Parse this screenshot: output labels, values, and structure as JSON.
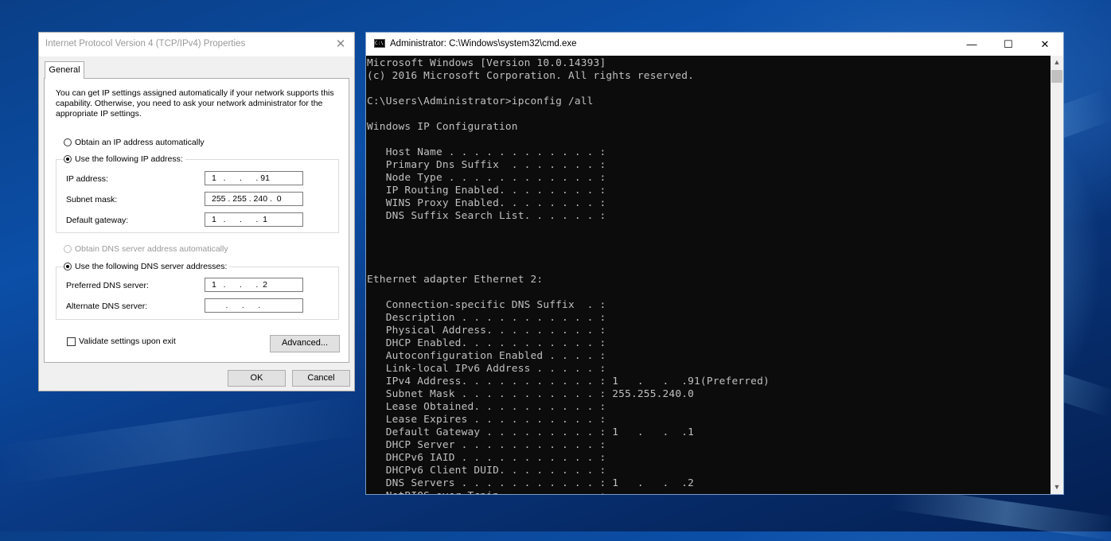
{
  "ipv4_dialog": {
    "title": "Internet Protocol Version 4 (TCP/IPv4) Properties",
    "tab": "General",
    "description": "You can get IP settings assigned automatically if your network supports this capability. Otherwise, you need to ask your network administrator for the appropriate IP settings.",
    "obtain_ip_auto": "Obtain an IP address automatically",
    "use_following_ip": "Use the following IP address:",
    "ip_address_label": "IP address:",
    "ip_address_value": "1   .      .      . 91",
    "subnet_mask_label": "Subnet mask:",
    "subnet_mask_value": "255 . 255 . 240 .  0",
    "default_gateway_label": "Default gateway:",
    "default_gateway_value": "1   .      .      .  1",
    "obtain_dns_auto": "Obtain DNS server address automatically",
    "use_following_dns": "Use the following DNS server addresses:",
    "preferred_dns_label": "Preferred DNS server:",
    "preferred_dns_value": "1   .      .      .  2",
    "alternate_dns_label": "Alternate DNS server:",
    "alternate_dns_value": "      .      .      .",
    "validate_label": "Validate settings upon exit",
    "advanced_button": "Advanced...",
    "ok_button": "OK",
    "cancel_button": "Cancel",
    "selected": {
      "ip_mode": "manual",
      "dns_mode": "manual",
      "validate": false
    }
  },
  "cmd_window": {
    "title": "Administrator: C:\\Windows\\system32\\cmd.exe",
    "icon_text": "C:\\",
    "minimize": "—",
    "maximize": "☐",
    "close": "✕",
    "output": "Microsoft Windows [Version 10.0.14393]\n(c) 2016 Microsoft Corporation. All rights reserved.\n\nC:\\Users\\Administrator>ipconfig /all\n\nWindows IP Configuration\n\n   Host Name . . . . . . . . . . . . :\n   Primary Dns Suffix  . . . . . . . :\n   Node Type . . . . . . . . . . . . :\n   IP Routing Enabled. . . . . . . . :\n   WINS Proxy Enabled. . . . . . . . :\n   DNS Suffix Search List. . . . . . :\n\n\n\n\nEthernet adapter Ethernet 2:\n\n   Connection-specific DNS Suffix  . :\n   Description . . . . . . . . . . . :\n   Physical Address. . . . . . . . . :\n   DHCP Enabled. . . . . . . . . . . :\n   Autoconfiguration Enabled . . . . :\n   Link-local IPv6 Address . . . . . :\n   IPv4 Address. . . . . . . . . . . : 1   .   .  .91(Preferred)\n   Subnet Mask . . . . . . . . . . . : 255.255.240.0\n   Lease Obtained. . . . . . . . . . :\n   Lease Expires . . . . . . . . . . :\n   Default Gateway . . . . . . . . . : 1   .   .  .1\n   DHCP Server . . . . . . . . . . . :\n   DHCPv6 IAID . . . . . . . . . . . :\n   DHCPv6 Client DUID. . . . . . . . :\n   DNS Servers . . . . . . . . . . . : 1   .   .  .2\n   NetBIOS over Tcpip. . . . . . . . :"
  },
  "colors": {
    "desktop": "#0b4fa8",
    "console_bg": "#0c0c0c",
    "console_text": "#c0c0c0",
    "dialog_bg": "#f0f0f0"
  }
}
